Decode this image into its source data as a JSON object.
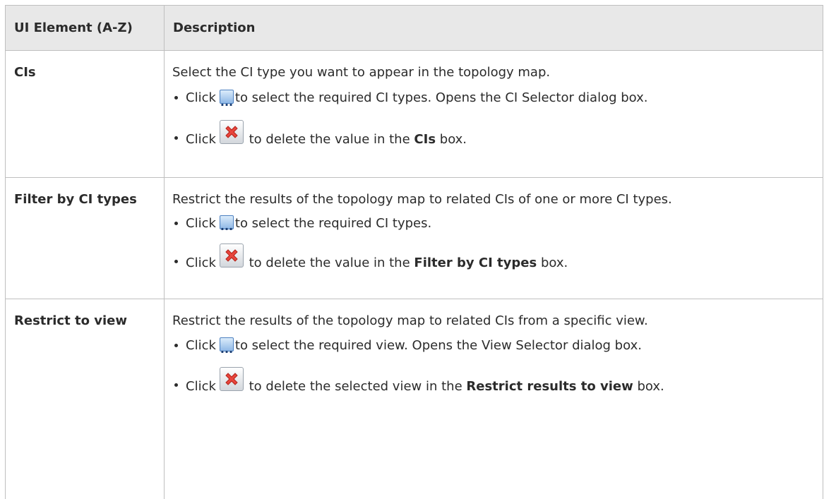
{
  "table": {
    "headers": {
      "element": "UI Element (A-Z)",
      "description": "Description"
    },
    "rows": [
      {
        "name": "CIs",
        "summary": "Select the CI type you want to appear in the topology map.",
        "bullet1": {
          "prefix": "Click",
          "icon": "browse-ellipsis-icon",
          "text": "to select the required CI types. Opens the CI Selector dialog box."
        },
        "bullet2": {
          "prefix": "Click",
          "icon": "delete-x-icon",
          "text_before": "to delete the value in the",
          "bold": "CIs",
          "text_after": "box."
        }
      },
      {
        "name": "Filter by CI types",
        "summary": "Restrict the results of the topology map to related CIs of one or more CI types.",
        "bullet1": {
          "prefix": "Click",
          "icon": "browse-ellipsis-icon",
          "text": "to select the required CI types."
        },
        "bullet2": {
          "prefix": "Click",
          "icon": "delete-x-icon",
          "text_before": "to delete the value in the",
          "bold": "Filter by CI types",
          "text_after": "box."
        }
      },
      {
        "name": "Restrict to view",
        "summary": "Restrict the results of the topology map to related CIs from a specific view.",
        "bullet1": {
          "prefix": "Click",
          "icon": "browse-ellipsis-icon",
          "text": "to select the required view. Opens the View Selector dialog box."
        },
        "bullet2": {
          "prefix": "Click",
          "icon": "delete-x-icon",
          "text_before": "to delete the selected view in the",
          "bold": "Restrict results to view",
          "text_after": "box."
        }
      }
    ]
  },
  "colors": {
    "header_bg": "#e8e8e8",
    "border": "#bfbfbf",
    "text": "#2b2b2b"
  }
}
